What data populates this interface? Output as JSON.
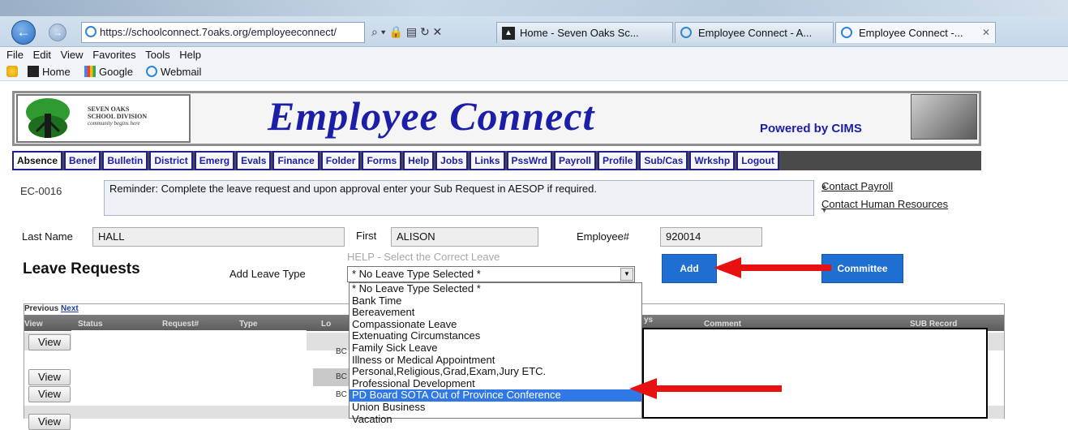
{
  "browser": {
    "url": "https://schoolconnect.7oaks.org/employeeconnect/",
    "address_icons": "⌕ ▾ 🔒 ▤ ↻ ✕",
    "tabs": [
      {
        "label": "Home - Seven Oaks Sc..."
      },
      {
        "label": "Employee Connect - A..."
      },
      {
        "label": "Employee Connect -..."
      }
    ],
    "menu": [
      "File",
      "Edit",
      "View",
      "Favorites",
      "Tools",
      "Help"
    ],
    "favorites": [
      "Home",
      "Google",
      "Webmail"
    ]
  },
  "header": {
    "logo_line1": "SEVEN OAKS",
    "logo_line2": "SCHOOL DIVISION",
    "logo_tagline": "community begins here",
    "title": "Employee Connect",
    "powered_by": "Powered by CIMS"
  },
  "nav": [
    "Absence",
    "Benef",
    "Bulletin",
    "District",
    "Emerg",
    "Evals",
    "Finance",
    "Folder",
    "Forms",
    "Help",
    "Jobs",
    "Links",
    "PssWrd",
    "Payroll",
    "Profile",
    "Sub/Cas",
    "Wrkshp",
    "Logout"
  ],
  "notice": {
    "code": "EC-0016",
    "message": "Reminder: Complete the leave request and upon approval enter your Sub Request in AESOP if required.",
    "links": [
      "Contact Payroll",
      "Contact Human Resources"
    ]
  },
  "employee": {
    "last_name_label": "Last Name",
    "last_name": "HALL",
    "first_label": "First",
    "first": "ALISON",
    "employee_no_label": "Employee#",
    "employee_no": "920014"
  },
  "leave": {
    "section_title": "Leave Requests",
    "add_type_label": "Add Leave Type",
    "help_text": "HELP - Select the Correct Leave",
    "selected": "* No Leave Type Selected *",
    "add_button": "Add",
    "committee_button": "Committee",
    "options": [
      "* No Leave Type Selected *",
      "Bank Time",
      "Bereavement",
      "Compassionate Leave",
      "Extenuating Circumstances",
      "Family Sick Leave",
      "Illness or Medical Appointment",
      "Personal,Religious,Grad,Exam,Jury ETC.",
      "Professional Development",
      "PD Board SOTA Out of Province Conference",
      "Union Business",
      "Vacation"
    ],
    "highlighted_index": 9
  },
  "grid": {
    "prev": "Previous",
    "next": "Next",
    "headers": [
      "View",
      "Status",
      "Request#",
      "Type",
      "Lo",
      "ys",
      "Comment",
      "SUB Record"
    ],
    "row_button": "View",
    "row_location": "BC"
  },
  "colors": {
    "accent_blue": "#1e6fd1",
    "brand_navy": "#1c1ea8",
    "arrow_red": "#e81010",
    "selection_blue": "#2f78e6"
  }
}
